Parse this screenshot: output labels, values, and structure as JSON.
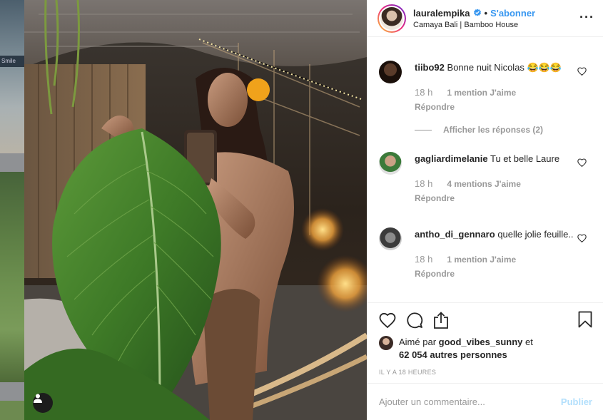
{
  "colors": {
    "accent": "#3897f0",
    "muted": "#999999",
    "publish_disabled": "#b2dffc"
  },
  "left_peek": {
    "sign_text": "Smile"
  },
  "post": {
    "username": "lauralempika",
    "verified_icon": "verified-badge-icon",
    "follow_label": "S'abonner",
    "location": "Camaya Bali | Bamboo House"
  },
  "comments": [
    {
      "user": "tiibo92",
      "text": "Bonne nuit Nicolas 😂😂😂",
      "time": "18 h",
      "likes": "1 mention J'aime",
      "reply": "Répondre",
      "view_replies": "Afficher les réponses (2)"
    },
    {
      "user": "gagliardimelanie",
      "text": "Tu et belle Laure",
      "time": "18 h",
      "likes": "4 mentions J'aime",
      "reply": "Répondre"
    },
    {
      "user": "antho_di_gennaro",
      "text": "quelle jolie feuille..",
      "time": "18 h",
      "likes": "1 mention J'aime",
      "reply": "Répondre"
    }
  ],
  "likes": {
    "prefix": "Aimé par",
    "user": "good_vibes_sunny",
    "joiner": "et",
    "others": "62 054 autres personnes"
  },
  "timestamp": "IL Y A 18 HEURES",
  "add_comment": {
    "placeholder": "Ajouter un commentaire...",
    "publish_label": "Publier"
  },
  "icons": [
    "heart-icon",
    "comment-icon",
    "share-icon",
    "bookmark-icon",
    "more-options-icon",
    "user-tag-icon"
  ]
}
